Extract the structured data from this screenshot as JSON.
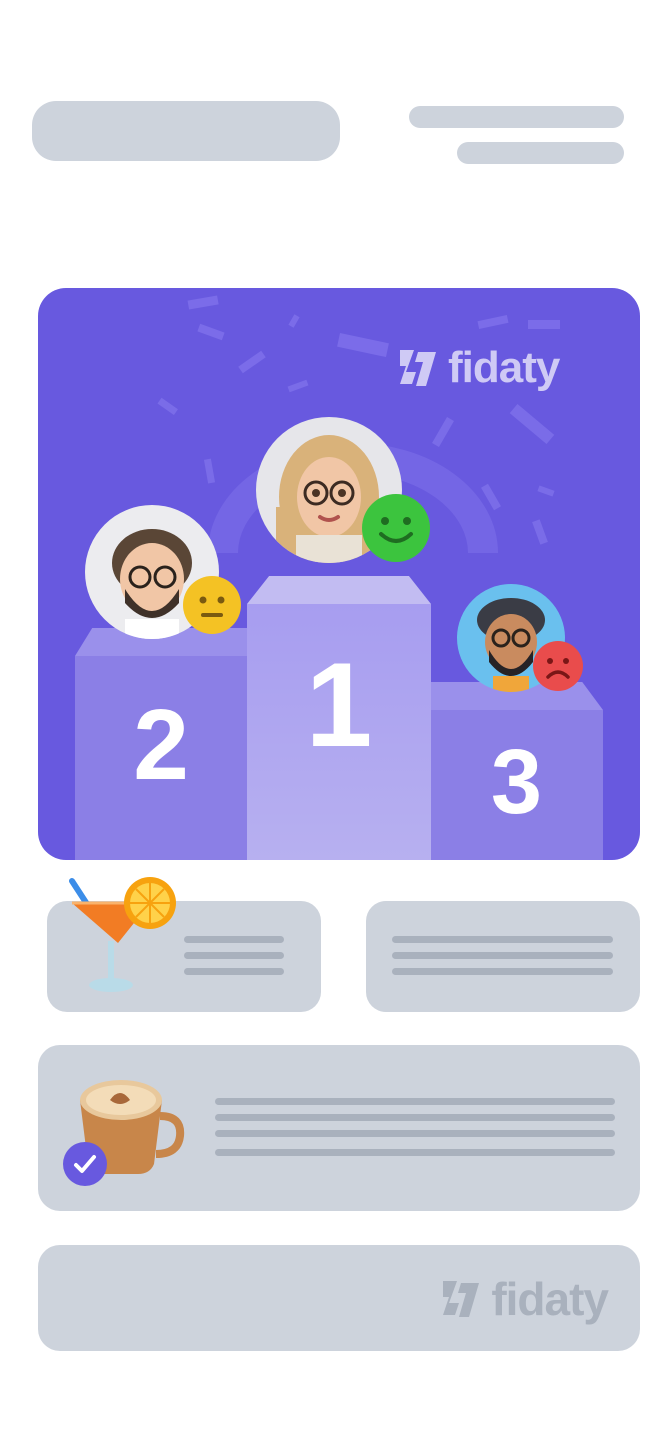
{
  "header": {
    "placeholder": true
  },
  "leaderboard": {
    "brand": "fidaty",
    "podium": [
      {
        "rank": "2",
        "mood": "neutral"
      },
      {
        "rank": "1",
        "mood": "happy"
      },
      {
        "rank": "3",
        "mood": "sad"
      }
    ]
  },
  "rewards": [
    {
      "icon": "cocktail-icon"
    },
    {
      "icon": ""
    },
    {
      "icon": "coffee-cup-icon",
      "badge": "check-badge-icon"
    }
  ],
  "footer": {
    "brand": "fidaty"
  },
  "colors": {
    "board": "#6859df",
    "skeleton": "#cdd3dc",
    "skeleton_line": "#a9b1bd",
    "happy": "#3cc43e",
    "neutral": "#f4c224",
    "sad": "#e94c4c"
  }
}
